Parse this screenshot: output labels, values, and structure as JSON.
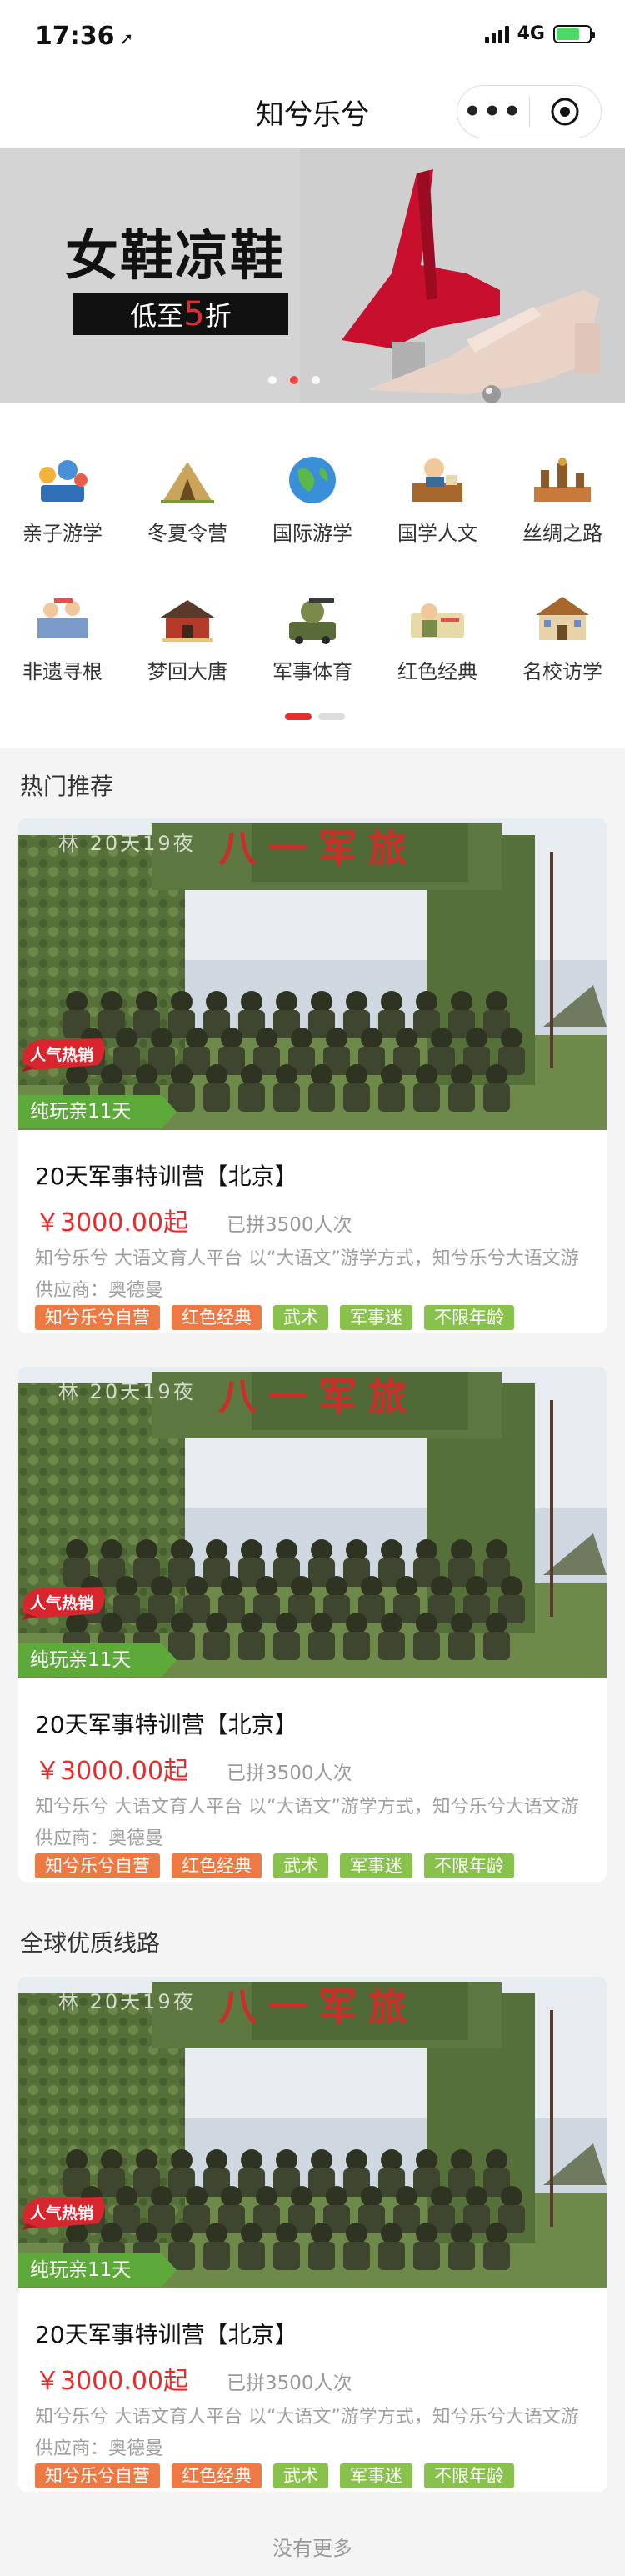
{
  "status_bar": {
    "time": "17:36",
    "network": "4G"
  },
  "nav": {
    "title": "知兮乐兮",
    "more_icon": "more-dots-icon",
    "target_icon": "close-target-icon"
  },
  "banner": {
    "headline": "女鞋凉鞋",
    "tag_prefix": "低至",
    "tag_number": "5",
    "tag_suffix": "折",
    "slides": 3,
    "active_slide": 1
  },
  "categories": [
    {
      "label": "亲子游学",
      "icon": "family-travel-icon"
    },
    {
      "label": "冬夏令营",
      "icon": "camp-tent-icon"
    },
    {
      "label": "国际游学",
      "icon": "globe-icon"
    },
    {
      "label": "国学人文",
      "icon": "classical-study-icon"
    },
    {
      "label": "丝绸之路",
      "icon": "silk-road-icon"
    },
    {
      "label": "非遗寻根",
      "icon": "heritage-icon"
    },
    {
      "label": "梦回大唐",
      "icon": "palace-icon"
    },
    {
      "label": "军事体育",
      "icon": "military-icon"
    },
    {
      "label": "红色经典",
      "icon": "red-classic-icon"
    },
    {
      "label": "名校访学",
      "icon": "school-icon"
    }
  ],
  "sections": {
    "hot": "热门推荐",
    "global": "全球优质线路"
  },
  "products": [
    {
      "name": "20天军事特训营【北京】",
      "price": "￥3000.00起",
      "sold": "已拼3500人次",
      "desc": "知兮乐兮 大语文育人平台 以“大语文”游学方式，知兮乐兮大语文游",
      "supplier": "供应商：奥德曼",
      "hot_badge": "人气热销",
      "days_badge": "纯玩亲11天",
      "photo_caption": "林 20天19夜",
      "banner_text": "八一军旅",
      "tags": [
        "知兮乐兮自营",
        "红色经典",
        "武术",
        "军事迷",
        "不限年龄"
      ]
    },
    {
      "name": "20天军事特训营【北京】",
      "price": "￥3000.00起",
      "sold": "已拼3500人次",
      "desc": "知兮乐兮 大语文育人平台 以“大语文”游学方式，知兮乐兮大语文游",
      "supplier": "供应商：奥德曼",
      "hot_badge": "人气热销",
      "days_badge": "纯玩亲11天",
      "photo_caption": "林 20天19夜",
      "banner_text": "八一军旅",
      "tags": [
        "知兮乐兮自营",
        "红色经典",
        "武术",
        "军事迷",
        "不限年龄"
      ]
    },
    {
      "name": "20天军事特训营【北京】",
      "price": "￥3000.00起",
      "sold": "已拼3500人次",
      "desc": "知兮乐兮 大语文育人平台 以“大语文”游学方式，知兮乐兮大语文游",
      "supplier": "供应商：奥德曼",
      "hot_badge": "人气热销",
      "days_badge": "纯玩亲11天",
      "photo_caption": "林 20天19夜",
      "banner_text": "八一军旅",
      "tags": [
        "知兮乐兮自营",
        "红色经典",
        "武术",
        "军事迷",
        "不限年龄"
      ]
    }
  ],
  "footer": "没有更多",
  "colors": {
    "accent_red": "#e82c2c",
    "tag_orange": "#ed7a45",
    "tag_green": "#88c24c",
    "days_green": "#5da93a"
  }
}
